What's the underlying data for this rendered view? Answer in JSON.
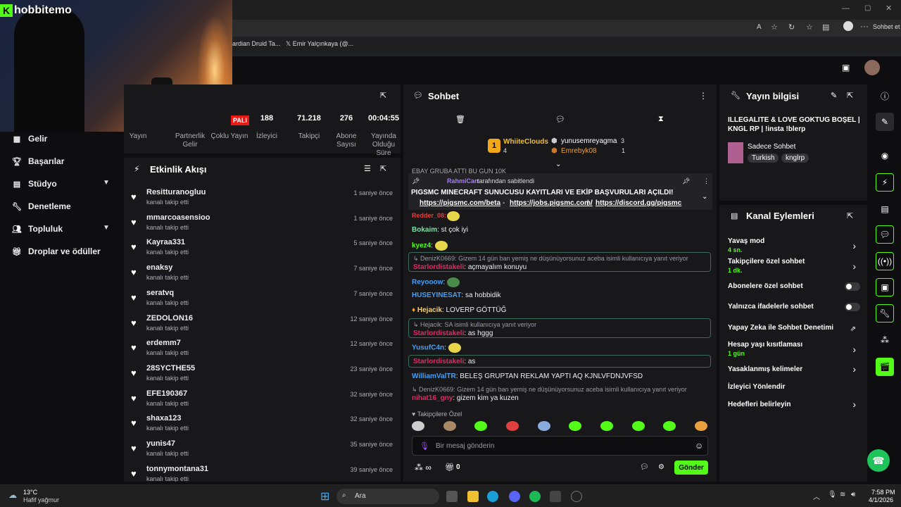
{
  "browser": {
    "bookmarks": [
      "ardian Druid Ta...",
      "Emir Yalçınkaya (@..."
    ],
    "profile_label": "Sohbet et"
  },
  "webcam": {
    "logo": "hobbitemo"
  },
  "nav": {
    "items": [
      {
        "label": "Gelir"
      },
      {
        "label": "Başarılar"
      },
      {
        "label": "Stüdyo"
      },
      {
        "label": "Denetleme"
      },
      {
        "label": "Topluluk"
      },
      {
        "label": "Droplar ve ödüller"
      }
    ]
  },
  "stats": {
    "badge": "PALI",
    "cols": [
      {
        "label": "Yayın",
        "value": ""
      },
      {
        "label": "Partnerlik Gelir",
        "value": ""
      },
      {
        "label": "Çoklu Yayın",
        "value": ""
      },
      {
        "label": "İzleyici",
        "value": "188"
      },
      {
        "label": "Takipçi",
        "value": "71.218"
      },
      {
        "label": "Abone Sayısı",
        "value": "276"
      },
      {
        "label": "Yayında Olduğu Süre",
        "value": "00:04:55"
      }
    ]
  },
  "events": {
    "title": "Etkinlik Akışı",
    "items": [
      {
        "name": "Resitturanogluu",
        "sub": "kanalı takip etti",
        "time": "1 saniye önce"
      },
      {
        "name": "mmarcoasensioo",
        "sub": "kanalı takip etti",
        "time": "1 saniye önce"
      },
      {
        "name": "Kayraa331",
        "sub": "kanalı takip etti",
        "time": "5 saniye önce"
      },
      {
        "name": "enaksy",
        "sub": "kanalı takip etti",
        "time": "7 saniye önce"
      },
      {
        "name": "seratvq",
        "sub": "kanalı takip etti",
        "time": "7 saniye önce"
      },
      {
        "name": "ZEDOLON16",
        "sub": "kanalı takip etti",
        "time": "12 saniye önce"
      },
      {
        "name": "erdemm7",
        "sub": "kanalı takip etti",
        "time": "12 saniye önce"
      },
      {
        "name": "28SYCTHE55",
        "sub": "kanalı takip etti",
        "time": "23 saniye önce"
      },
      {
        "name": "EFE190367",
        "sub": "kanalı takip etti",
        "time": "32 saniye önce"
      },
      {
        "name": "shaxa123",
        "sub": "kanalı takip etti",
        "time": "32 saniye önce"
      },
      {
        "name": "yunis47",
        "sub": "kanalı takip etti",
        "time": "35 saniye önce"
      },
      {
        "name": "tonnymontana31",
        "sub": "kanalı takip etti",
        "time": "39 saniye önce"
      }
    ]
  },
  "chat": {
    "title": "Sohbet",
    "leaders": {
      "first_name": "WhiiteClouds",
      "first_count": "4",
      "second_name": "yunusemreyagma",
      "second_count": "3",
      "third_name": "Emrebyk08",
      "third_count": "1"
    },
    "pinned": {
      "by": "RahmiCan",
      "by_suffix": "tarafından sabitlendi",
      "title": "PIGSMC MINECRAFT SUNUCUSU KAYITLARI VE EKİP BAŞVURULARI AÇILDI!",
      "link1": "https://pigsmc.com/beta",
      "link2": "https://jobs.pigsmc.com/",
      "link3": "https://discord.gg/pigsmc"
    },
    "top_msg": "EBAY GRUBA ATTI BU GUN 10K",
    "messages": [
      {
        "user": "Bokaim",
        "text": ": st çok iyi"
      },
      {
        "user": "kyez4",
        "text": ":"
      },
      {
        "reply": "DenizK0669: Gizem 14 gün ban yemiş ne düşünüyorsunuz aceba isimli kullanıcıya yanıt veriyor",
        "user": "Starlordistakeli",
        "text": ": açmayalım konuyu"
      },
      {
        "user": "Reyooow",
        "text": ":"
      },
      {
        "user": "HUSEYINESAT",
        "text": ": sa hobbidik"
      },
      {
        "user": "Hejacik",
        "text": ": LOVERP GÖTTÜĞ"
      },
      {
        "reply": "Hejacik: SA isimli kullanıcıya yanıt veriyor",
        "user": "Starlordistakeli",
        "text": ": as hggg"
      },
      {
        "user": "YusufC4n",
        "text": ":"
      },
      {
        "reply": "",
        "user": "Starlordistakeli",
        "text": ": as"
      },
      {
        "user": "WilliamValTR",
        "text": ": BELEŞ GRUPTAN REKLAM YAPTI AQ KJNLVFDNJVFSD"
      },
      {
        "reply": "DenizK0669: Gizem 14 gün ban yemiş ne düşünüyorsunuz aceba isimli kullanıcıya yanıt veriyor",
        "user": "nihat16_gny",
        "text": ": gizem kim ya kuzen"
      }
    ],
    "followers_only": "Takipçilere Özel",
    "input_placeholder": "Bir mesaj gönderin",
    "count": "0",
    "send": "Gönder"
  },
  "info": {
    "title": "Yayın bilgisi",
    "stream_title": "ILLEGALITE & LOVE GOKTUG BOŞEL | KNGL RP | !insta !blerp",
    "category": "Sadece Sohbet",
    "tags": [
      "Turkish",
      "knglrp"
    ]
  },
  "actions": {
    "title": "Kanal Eylemleri",
    "items": [
      {
        "label": "Yavaş mod",
        "sub": "4 sn."
      },
      {
        "label": "Takipçilere özel sohbet",
        "sub": "1 dk."
      },
      {
        "label": "Abonelere özel sohbet",
        "sub": ""
      },
      {
        "label": "Yalnızca ifadelerle sohbet",
        "sub": ""
      },
      {
        "label": "Yapay Zeka ile Sohbet Denetimi",
        "sub": ""
      },
      {
        "label": "Hesap yaşı kısıtlaması",
        "sub": "1 gün"
      },
      {
        "label": "Yasaklanmış kelimeler",
        "sub": ""
      },
      {
        "label": "İzleyici Yönlendir",
        "sub": ""
      },
      {
        "label": "Hedefleri belirleyin",
        "sub": ""
      }
    ]
  },
  "taskbar": {
    "weather_temp": "13°C",
    "weather_desc": "Hafif yağmur",
    "search": "Ara",
    "time": "7:58 PM",
    "date": "4/1/2026"
  },
  "colors": {
    "accent": "#53fc18",
    "panel": "#18181b",
    "bg": "#0e0e10"
  }
}
